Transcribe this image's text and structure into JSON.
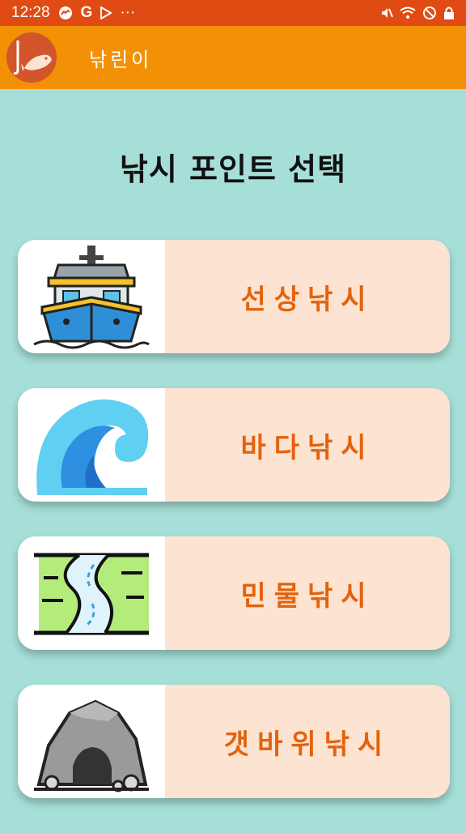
{
  "status_bar": {
    "time": "12:28",
    "left_icons": [
      "messenger-icon",
      "google-icon",
      "play-icon",
      "more-dots-icon"
    ],
    "right_icons": [
      "mute-icon",
      "wifi-icon",
      "no-disturb-icon",
      "lock-icon"
    ],
    "more": "···"
  },
  "app_bar": {
    "title": "낚린이",
    "logo_icon": "fishing-logo-icon",
    "color": "#f39106"
  },
  "main": {
    "title": "낚시 포인트 선택",
    "options": [
      {
        "label": "선상낚시",
        "icon": "ship-icon"
      },
      {
        "label": "바다낚시",
        "icon": "wave-icon"
      },
      {
        "label": "민물낚시",
        "icon": "river-icon"
      },
      {
        "label": "갯바위낚시",
        "icon": "cave-rock-icon"
      }
    ]
  },
  "colors": {
    "background": "#a6dfd8",
    "status_bar": "#e04a13",
    "card_label_bg": "#fde3d1",
    "card_label_text": "#e2630d"
  }
}
